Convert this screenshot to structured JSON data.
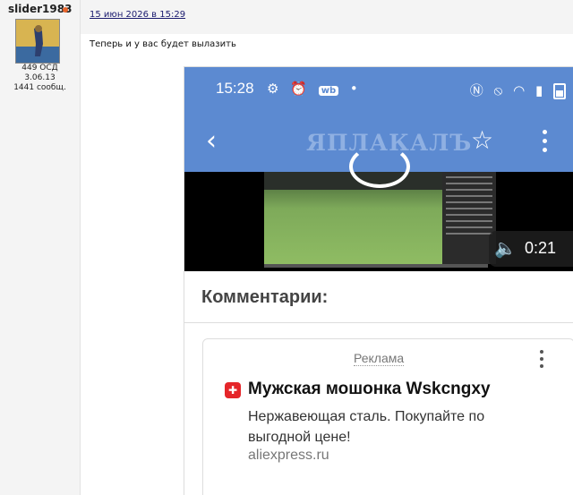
{
  "author": {
    "name": "slider1983",
    "rating": "449 ОСД",
    "registered": "3.06.13",
    "posts": "1441 сообщ."
  },
  "post": {
    "date": "15 июн 2026 в 15:29",
    "text": "Теперь и у вас будет вылазить"
  },
  "screenshot": {
    "status_time": "15:28",
    "wb_badge": "wb",
    "app_logo": "ЯПЛАКАЛЪ",
    "video_time": "0:21",
    "comments_title": "Комментарии:",
    "ad": {
      "label": "Реклама",
      "title": "Мужская мошонка Wskcngxy",
      "description": "Нержавеющая сталь. Покупайте по выгодной цене!",
      "domain": "aliexpress.ru"
    }
  },
  "colors": {
    "app_bar": "#5c8ad1",
    "online_dot": "#e8632a",
    "ad_icon": "#e5262a"
  },
  "icons": [
    "online-status-icon",
    "back-arrow-icon",
    "star-icon",
    "more-vert-icon",
    "speaker-icon",
    "play-icon",
    "alarm-icon",
    "nfc-icon",
    "wifi-icon",
    "signal-icon",
    "battery-icon",
    "ad-brand-icon"
  ]
}
